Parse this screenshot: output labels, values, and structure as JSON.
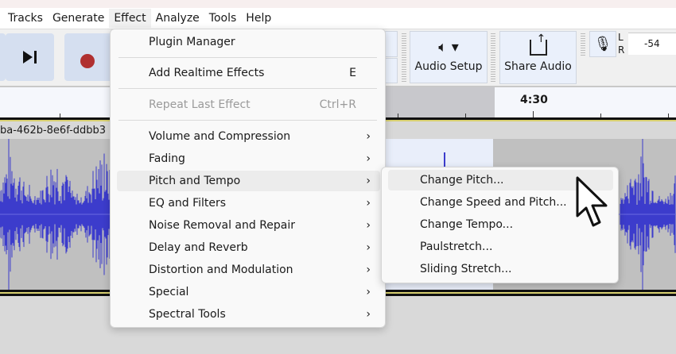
{
  "menubar": {
    "items": [
      "Tracks",
      "Generate",
      "Effect",
      "Analyze",
      "Tools",
      "Help"
    ],
    "active": "Effect"
  },
  "toolbar": {
    "audio_setup": "Audio Setup",
    "share_audio": "Share Audio",
    "meter": {
      "l": "L",
      "r": "R",
      "scale": "-54"
    }
  },
  "ruler": {
    "label": "4:30"
  },
  "track": {
    "clip_name": "ba-462b-8e6f-ddbb3"
  },
  "effect_menu": {
    "plugin_manager": "Plugin Manager",
    "add_realtime": {
      "label": "Add Realtime Effects",
      "shortcut": "E"
    },
    "repeat_last": {
      "label": "Repeat Last Effect",
      "shortcut": "Ctrl+R",
      "disabled": true
    },
    "submenus": [
      "Volume and Compression",
      "Fading",
      "Pitch and Tempo",
      "EQ and Filters",
      "Noise Removal and Repair",
      "Delay and Reverb",
      "Distortion and Modulation",
      "Special",
      "Spectral Tools"
    ],
    "highlighted": "Pitch and Tempo"
  },
  "pitch_tempo_submenu": {
    "items": [
      "Change Pitch...",
      "Change Speed and Pitch...",
      "Change Tempo...",
      "Paulstretch...",
      "Sliding Stretch..."
    ],
    "highlighted": "Change Pitch..."
  },
  "colors": {
    "waveform": "#3c3ccc",
    "record": "#b03030",
    "selection": "#e9eefa"
  }
}
